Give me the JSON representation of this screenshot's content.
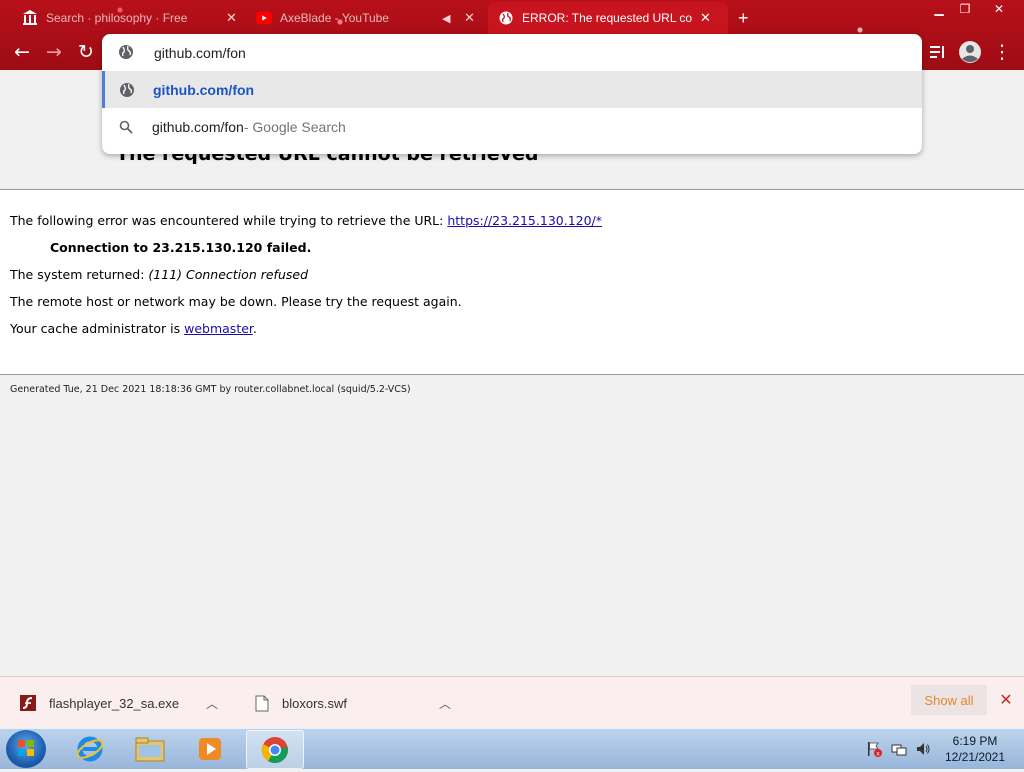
{
  "tabs": [
    {
      "title": "Search · philosophy · Free",
      "icon": "institution-icon"
    },
    {
      "title": "AxeBlade - YouTube",
      "icon": "youtube-icon"
    },
    {
      "title": "ERROR: The requested URL cou",
      "icon": "globe-icon",
      "active": true
    }
  ],
  "new_tab_label": "+",
  "omnibox": {
    "value": "github.com/fon",
    "suggestions": [
      {
        "text": "github.com/fon",
        "icon": "globe-icon"
      },
      {
        "text": "github.com/fon",
        "suffix": " - Google Search",
        "icon": "search-icon"
      }
    ]
  },
  "page": {
    "heading": "The requested URL cannot be retrieved",
    "intro": "The following error was encountered while trying to retrieve the URL: ",
    "url": "https://23.215.130.120/*",
    "connection_failed": "Connection to 23.215.130.120 failed.",
    "system_returned_label": "The system returned: ",
    "system_returned_value": "(111) Connection refused",
    "remote_down": "The remote host or network may be down. Please try the request again.",
    "cache_admin_label": "Your cache administrator is ",
    "cache_admin_link": "webmaster",
    "cache_admin_end": ".",
    "footer": "Generated Tue, 21 Dec 2021 18:18:36 GMT by router.collabnet.local (squid/5.2-VCS)"
  },
  "downloads": {
    "items": [
      {
        "name": "flashplayer_32_sa.exe",
        "icon": "flash-icon"
      },
      {
        "name": "bloxors.swf",
        "icon": "file-icon"
      }
    ],
    "show_all": "Show all"
  },
  "taskbar": {
    "time": "6:19 PM",
    "date": "12/21/2021"
  },
  "colors": {
    "theme_red": "#b8101a",
    "suggest_highlight": "#1a55c8",
    "show_all_text": "#e08a2c"
  }
}
